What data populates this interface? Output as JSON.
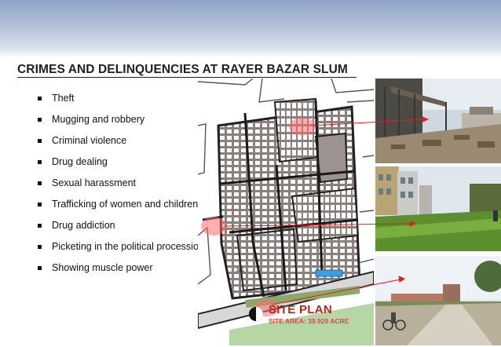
{
  "slide": {
    "title": "CRIMES AND DELINQUENCIES AT RAYER BAZAR SLUM",
    "bullets": [
      "Theft",
      "Mugging and robbery",
      "Criminal violence",
      "Drug dealing",
      "Sexual harassment",
      "Trafficking of women and children",
      "Drug addiction",
      "Picketing in the political procession",
      "Showing muscle power"
    ]
  },
  "map": {
    "label": "SITE PLAN",
    "area": "SITE AREA: 39.929 ACRE"
  },
  "colors": {
    "title": "#1f1f1f",
    "header": "#8fa3c6",
    "blocks": "#7d7371",
    "highlight": "#ff5a5a",
    "site_label": "#c0392b"
  }
}
